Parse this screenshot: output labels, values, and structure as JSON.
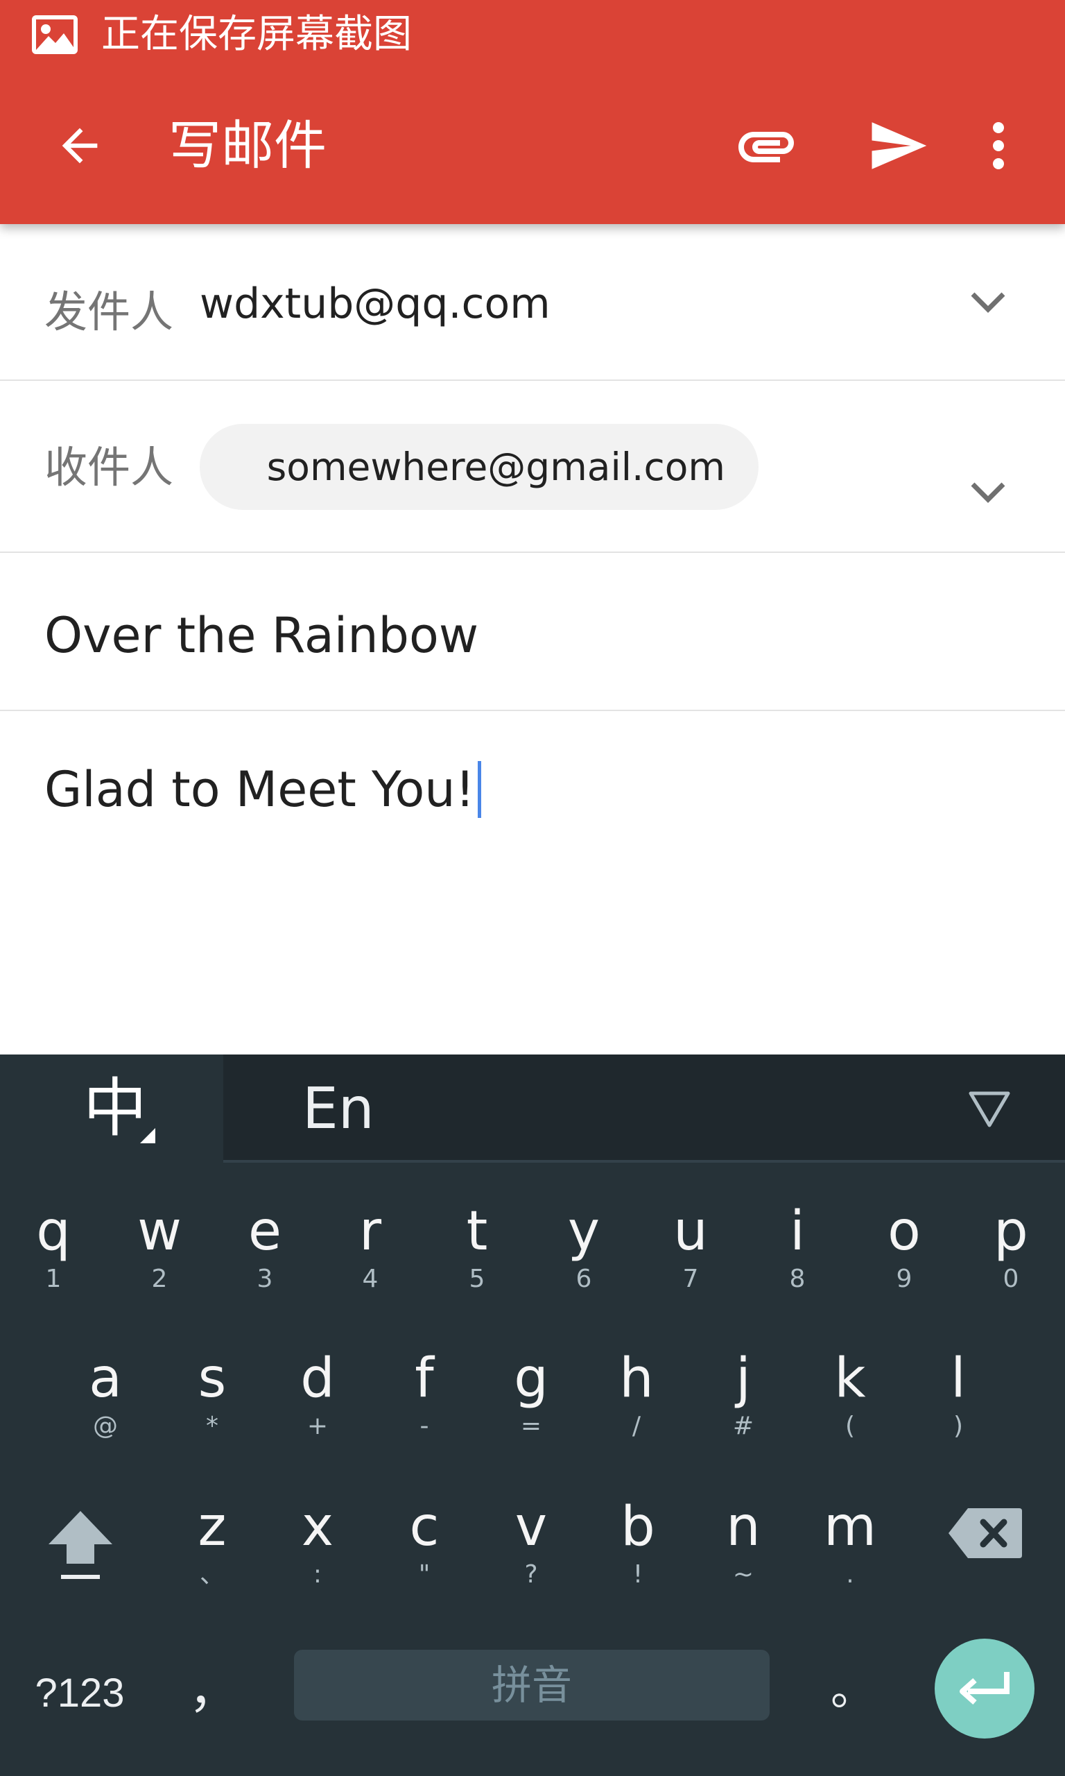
{
  "status_bar": {
    "icon": "image-icon",
    "text": "正在保存屏幕截图"
  },
  "toolbar": {
    "title": "写邮件",
    "back_icon": "arrow-back-icon",
    "attach_icon": "paperclip-icon",
    "send_icon": "send-icon",
    "more_icon": "more-vert-icon"
  },
  "compose": {
    "from_label": "发件人",
    "from_value": "wdxtub@qq.com",
    "to_label": "收件人",
    "to_recipient": "somewhere@gmail.com",
    "subject": "Over the Rainbow",
    "body": "Glad to Meet You!"
  },
  "keyboard": {
    "lang_zh": "中",
    "lang_en": "En",
    "row1": [
      {
        "key": "q",
        "sub": "1"
      },
      {
        "key": "w",
        "sub": "2"
      },
      {
        "key": "e",
        "sub": "3"
      },
      {
        "key": "r",
        "sub": "4"
      },
      {
        "key": "t",
        "sub": "5"
      },
      {
        "key": "y",
        "sub": "6"
      },
      {
        "key": "u",
        "sub": "7"
      },
      {
        "key": "i",
        "sub": "8"
      },
      {
        "key": "o",
        "sub": "9"
      },
      {
        "key": "p",
        "sub": "0"
      }
    ],
    "row2": [
      {
        "key": "a",
        "sub": "@"
      },
      {
        "key": "s",
        "sub": "*"
      },
      {
        "key": "d",
        "sub": "+"
      },
      {
        "key": "f",
        "sub": "-"
      },
      {
        "key": "g",
        "sub": "="
      },
      {
        "key": "h",
        "sub": "/"
      },
      {
        "key": "j",
        "sub": "#"
      },
      {
        "key": "k",
        "sub": "("
      },
      {
        "key": "l",
        "sub": ")"
      }
    ],
    "row3": [
      {
        "key": "z",
        "sub": "、"
      },
      {
        "key": "x",
        "sub": ":"
      },
      {
        "key": "c",
        "sub": "\""
      },
      {
        "key": "v",
        "sub": "?"
      },
      {
        "key": "b",
        "sub": "!"
      },
      {
        "key": "n",
        "sub": "~"
      },
      {
        "key": "m",
        "sub": "."
      }
    ],
    "symbols_label": "?123",
    "comma": "，",
    "space_label": "拼音",
    "period": "。"
  },
  "colors": {
    "app_bar": "#da4336",
    "keyboard_bg": "#263238",
    "enter_key": "#7ecfc3",
    "caret": "#4a86e8"
  }
}
